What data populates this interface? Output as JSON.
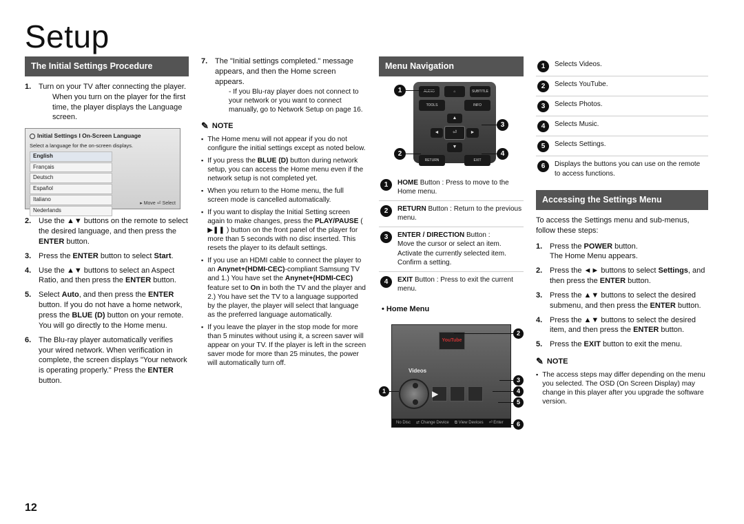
{
  "page_number": "12",
  "title": "Setup",
  "col1": {
    "band": "The Initial Settings Procedure",
    "steps": [
      {
        "n": "1.",
        "t": "Turn on your TV after connecting the player.",
        "sub": "When you turn on the player for the first time, the player displays the Language screen."
      },
      {
        "n": "2.",
        "t": "Use the ▲▼ buttons on the remote to select the desired language, and then press the <b>ENTER</b> button."
      },
      {
        "n": "3.",
        "t": "Press the <b>ENTER</b> button to select <b>Start</b>."
      },
      {
        "n": "4.",
        "t": "Use the ▲▼ buttons to select an Aspect Ratio, and then press the <b>ENTER</b> button."
      },
      {
        "n": "5.",
        "t": "Select <b>Auto</b>, and then press the <b>ENTER</b> button. If you do not have a home network, press the <b>BLUE (D)</b> button on your remote. You will go directly to the Home menu."
      },
      {
        "n": "6.",
        "t": "The Blu-ray player automatically verifies your wired network. When verification in complete, the screen displays \"Your network is operating properly.\" Press the <b>ENTER</b> button."
      }
    ],
    "langshot": {
      "header": "Initial Settings I On-Screen Language",
      "sub": "Select a language for the on-screen displays.",
      "opts": [
        "English",
        "Français",
        "Deutsch",
        "Español",
        "Italiano",
        "Nederlands"
      ],
      "foot": "▸ Move   ⏎ Select"
    }
  },
  "col2": {
    "step7": {
      "n": "7.",
      "t": "The \"Initial settings completed.\" message appears, and then the Home screen appears.",
      "sub": "- If you Blu-ray player does not connect to your network or you want to connect manually, go to Network Setup on page 16."
    },
    "note_label": "NOTE",
    "notes": [
      "The Home menu will not appear if you do not configure the initial settings except as noted below.",
      "If you press the <b>BLUE (D)</b> button during network setup, you can access the Home menu even if the network setup is not completed yet.",
      "When you return to the Home menu, the full screen mode is cancelled automatically.",
      "If you want to display the Initial Setting screen again to make changes, press the <b>PLAY/PAUSE</b> ( ▶❚❚ ) button on the front panel of the player for more than 5 seconds with no disc inserted. This resets the player to its default settings.",
      "If you use an HDMI cable to connect the player to an <b>Anynet+(HDMI-CEC)</b>-compliant Samsung TV and 1.) You have set the <b>Anynet+(HDMI-CEC)</b> feature set to <b>On</b> in both the TV and the player and 2.) You have set the TV to a language supported by the player, the player will select that language as the preferred language automatically.",
      "If you leave the player in the stop mode for more than 5 minutes without using it, a screen saver will appear on your TV. If the player is left in the screen saver mode for more than 25 minutes, the power will automatically turn off."
    ]
  },
  "col3": {
    "band": "Menu Navigation",
    "remote_btns": {
      "top": [
        "AUDIO",
        "HOME",
        "SUBTITLE"
      ],
      "mid": [
        "TOOLS",
        "INFO"
      ],
      "bot": [
        "RETURN",
        "EXIT"
      ]
    },
    "desc": [
      {
        "n": "1",
        "t": "<b>HOME</b> Button : Press to move to the Home menu."
      },
      {
        "n": "2",
        "t": "<b>RETURN</b> Button : Return to the previous menu."
      },
      {
        "n": "3",
        "t": "<b>ENTER / DIRECTION</b> Button :<br>Move the cursor or select an item.<br>Activate the currently selected item.<br>Confirm a setting."
      },
      {
        "n": "4",
        "t": "<b>EXIT</b> Button : Press to exit the current menu."
      }
    ],
    "home_label": "• Home Menu",
    "home_tile": "Videos",
    "home_yt": "YouTube",
    "home_bar": [
      "No Disc",
      "⇄ Change Device",
      "⧉ View Devices",
      "⏎ Enter"
    ]
  },
  "col4": {
    "legend": [
      {
        "n": "1",
        "t": "Selects Videos."
      },
      {
        "n": "2",
        "t": "Selects YouTube."
      },
      {
        "n": "3",
        "t": "Selects Photos."
      },
      {
        "n": "4",
        "t": "Selects Music."
      },
      {
        "n": "5",
        "t": "Selects Settings."
      },
      {
        "n": "6",
        "t": "Displays the buttons you can use on the remote to access functions."
      }
    ],
    "band": "Accessing the Settings Menu",
    "intro": "To access the Settings menu and sub-menus, follow these steps:",
    "steps": [
      {
        "n": "1.",
        "t": "Press the <b>POWER</b> button.<br>The Home Menu appears."
      },
      {
        "n": "2.",
        "t": "Press the ◄► buttons to select <b>Settings</b>, and then press the <b>ENTER</b> button."
      },
      {
        "n": "3.",
        "t": "Press the ▲▼ buttons to select the desired submenu, and then press the <b>ENTER</b> button."
      },
      {
        "n": "4.",
        "t": "Press the ▲▼ buttons to select the desired item, and then press the <b>ENTER</b> button."
      },
      {
        "n": "5.",
        "t": "Press the <b>EXIT</b> button to exit the menu."
      }
    ],
    "note_label": "NOTE",
    "notes": [
      "The access steps may differ depending on the menu you selected. The OSD (On Screen Display) may change in this player after you upgrade the software version."
    ]
  }
}
